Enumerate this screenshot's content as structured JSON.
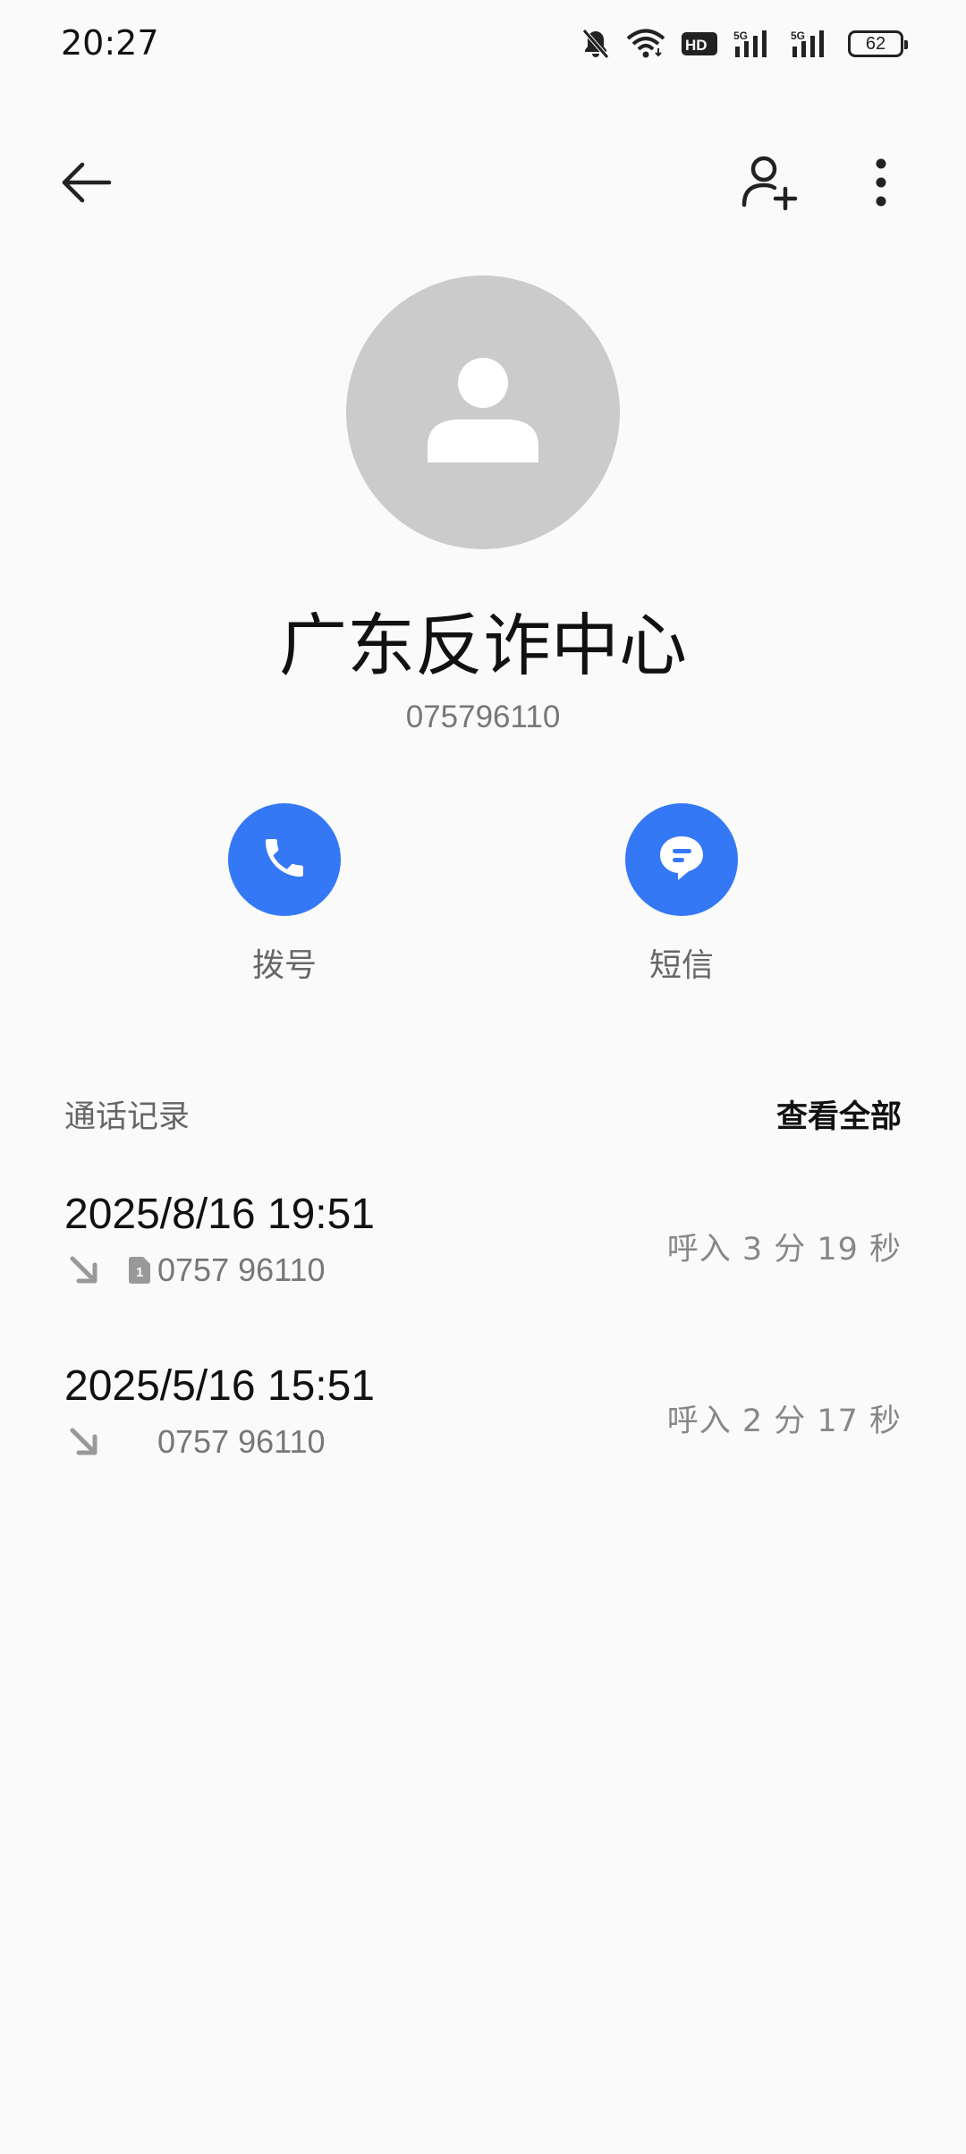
{
  "status_bar": {
    "time": "20:27",
    "battery": "62",
    "icons": [
      "mute-bell-icon",
      "wifi-icon",
      "hd-icon",
      "signal-5g-icon",
      "signal-5g-icon",
      "battery-icon"
    ]
  },
  "top_bar": {
    "icons": [
      "back-arrow-icon",
      "add-contact-icon",
      "more-vert-icon"
    ]
  },
  "contact": {
    "name": "广东反诈中心",
    "number": "075796110"
  },
  "actions": {
    "call_label": "拨号",
    "sms_label": "短信"
  },
  "call_log": {
    "title": "通话记录",
    "view_all": "查看全部",
    "entries": [
      {
        "datetime": "2025/8/16 19:51",
        "number": "0757 96110",
        "sim": "1",
        "detail": "呼入  3 分 19 秒"
      },
      {
        "datetime": "2025/5/16 15:51",
        "number": "0757 96110",
        "detail": "呼入  2 分 17 秒"
      }
    ]
  },
  "colors": {
    "accent": "#3478f6",
    "avatar_bg": "#cbcbcb",
    "background": "#fafafa"
  }
}
